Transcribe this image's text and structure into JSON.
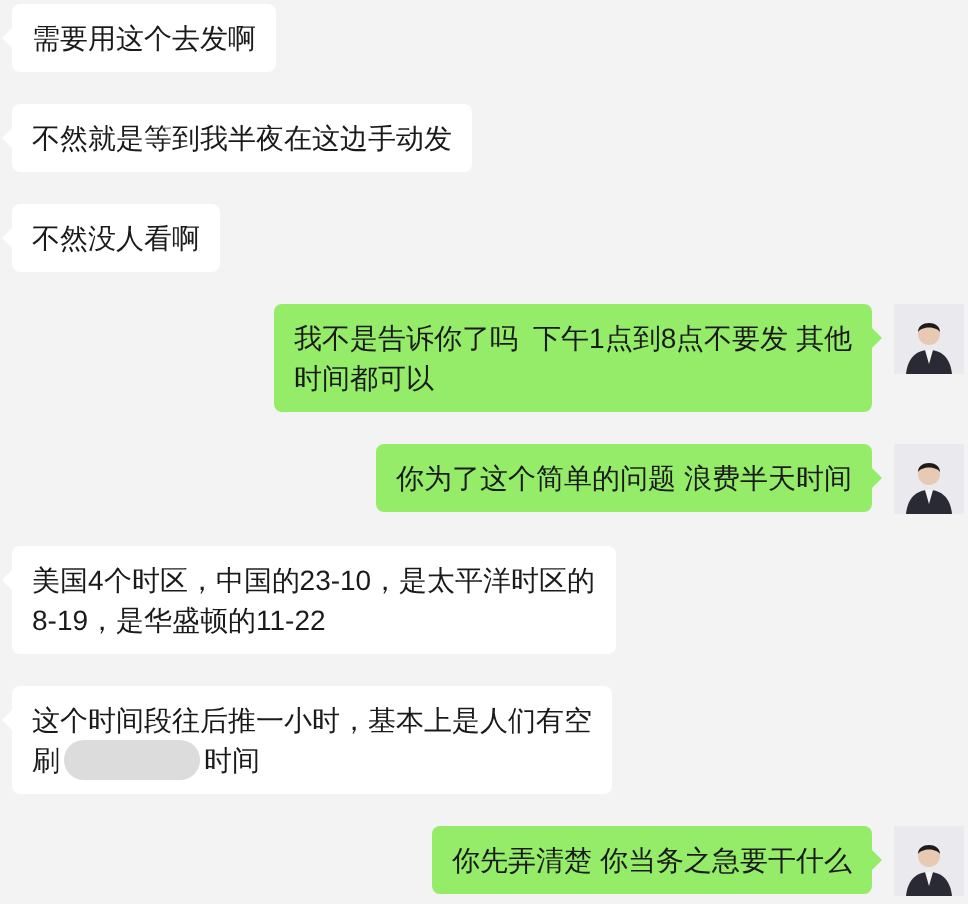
{
  "messages": [
    {
      "kind": "left",
      "segments": [
        {
          "kind": "text",
          "text": "需要用这个去发啊"
        }
      ]
    },
    {
      "kind": "left",
      "segments": [
        {
          "kind": "text",
          "text": "不然就是等到我半夜在这边手动发"
        }
      ]
    },
    {
      "kind": "left",
      "segments": [
        {
          "kind": "text",
          "text": "不然没人看啊"
        }
      ]
    },
    {
      "kind": "right",
      "segments": [
        {
          "kind": "text",
          "text": "我不是告诉你了吗  下午1点到8点不要发 其他"
        },
        {
          "kind": "break"
        },
        {
          "kind": "text",
          "text": "时间都可以"
        }
      ]
    },
    {
      "kind": "right",
      "segments": [
        {
          "kind": "text",
          "text": "你为了这个简单的问题 浪费半天时间"
        }
      ]
    },
    {
      "kind": "left",
      "segments": [
        {
          "kind": "text",
          "text": "美国4个时区，中国的23-10，是太平洋时区的"
        },
        {
          "kind": "break"
        },
        {
          "kind": "text",
          "text": "8-19，是华盛顿的11-22"
        }
      ]
    },
    {
      "kind": "left",
      "segments": [
        {
          "kind": "text",
          "text": "这个时间段往后推一小时，基本上是人们有空"
        },
        {
          "kind": "break"
        },
        {
          "kind": "text",
          "text": "刷"
        },
        {
          "kind": "blur"
        },
        {
          "kind": "text",
          "text": "时间"
        }
      ]
    },
    {
      "kind": "right",
      "segments": [
        {
          "kind": "text",
          "text": "你先弄清楚 你当务之急要干什么"
        }
      ]
    }
  ]
}
